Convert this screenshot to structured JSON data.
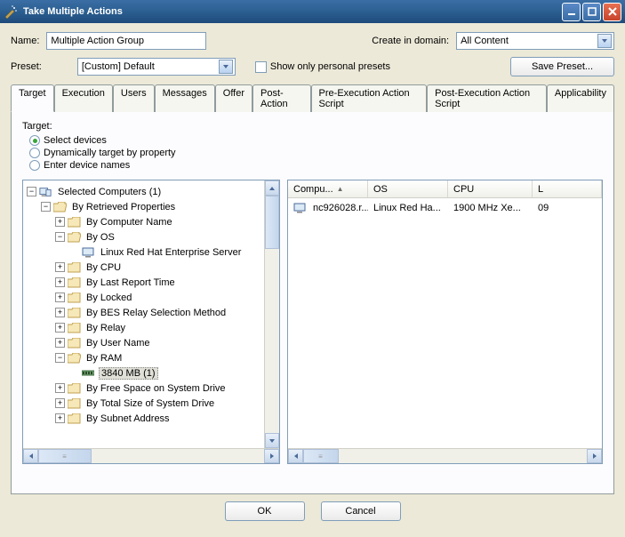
{
  "window": {
    "title": "Take Multiple Actions"
  },
  "form": {
    "name_label": "Name:",
    "name_value": "Multiple Action Group",
    "domain_label": "Create in domain:",
    "domain_value": "All Content",
    "preset_label": "Preset:",
    "preset_value": "[Custom] Default",
    "show_personal_label": "Show only personal presets",
    "save_preset_label": "Save Preset..."
  },
  "tabs": [
    "Target",
    "Execution",
    "Users",
    "Messages",
    "Offer",
    "Post-Action",
    "Pre-Execution Action Script",
    "Post-Execution Action Script",
    "Applicability"
  ],
  "target_panel": {
    "label": "Target:",
    "radios": {
      "select_devices": "Select devices",
      "dynamic": "Dynamically target by property",
      "enter_names": "Enter device names"
    }
  },
  "tree": {
    "root": "Selected Computers (1)",
    "retrieved": "By Retrieved Properties",
    "nodes": [
      "By Computer Name",
      "By OS",
      "By CPU",
      "By Last Report Time",
      "By Locked",
      "By BES Relay Selection Method",
      "By Relay",
      "By User Name",
      "By RAM",
      "By Free Space on System Drive",
      "By Total Size of System Drive",
      "By Subnet Address"
    ],
    "os_leaf": "Linux Red Hat Enterprise Server",
    "ram_leaf": "3840 MB (1)"
  },
  "table": {
    "columns": [
      "Compu...",
      "OS",
      "CPU",
      "L"
    ],
    "row": {
      "computer": "nc926028.r...",
      "os": "Linux Red Ha...",
      "cpu": "1900 MHz Xe...",
      "last": "09"
    }
  },
  "footer": {
    "ok": "OK",
    "cancel": "Cancel"
  }
}
